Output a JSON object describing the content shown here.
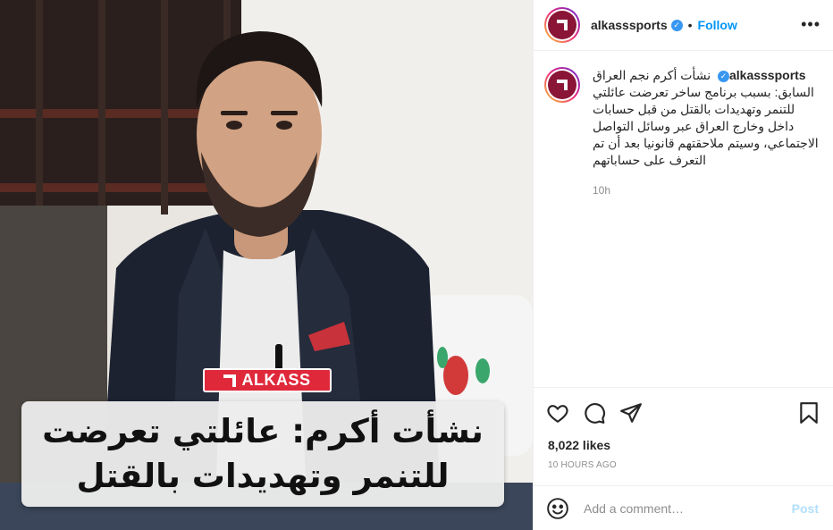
{
  "media": {
    "brand_badge": "ALKASS",
    "headline_lines": [
      "نشأت أكرم: عائلتي تعرضت",
      "للتنمر وتهديدات بالقتل"
    ]
  },
  "header": {
    "username": "alkasssports",
    "separator": "•",
    "follow_label": "Follow",
    "more_label": "•••"
  },
  "caption": {
    "username": "alkasssports",
    "text": "نشأت أكرم نجم العراق السابق: بسبب برنامج ساخر تعرضت عائلتي للتنمر وتهديدات بالقتل من قبل حسابات داخل وخارج العراق عبر وسائل التواصل الاجتماعي، وسيتم ملاحقتهم قانونيا بعد أن تم التعرف على حساباتهم",
    "time": "10h"
  },
  "actions": {
    "likes": "8,022 likes",
    "time_ago": "10 hours ago"
  },
  "comment": {
    "placeholder": "Add a comment…",
    "post_label": "Post"
  },
  "colors": {
    "brand_red": "#e0283b",
    "avatar_maroon": "#8a1537",
    "link_blue": "#0095f6",
    "verified_blue": "#3897f0"
  },
  "icons": [
    "heart-icon",
    "comment-icon",
    "share-icon",
    "bookmark-icon",
    "emoji-icon",
    "verified-icon",
    "more-icon"
  ]
}
